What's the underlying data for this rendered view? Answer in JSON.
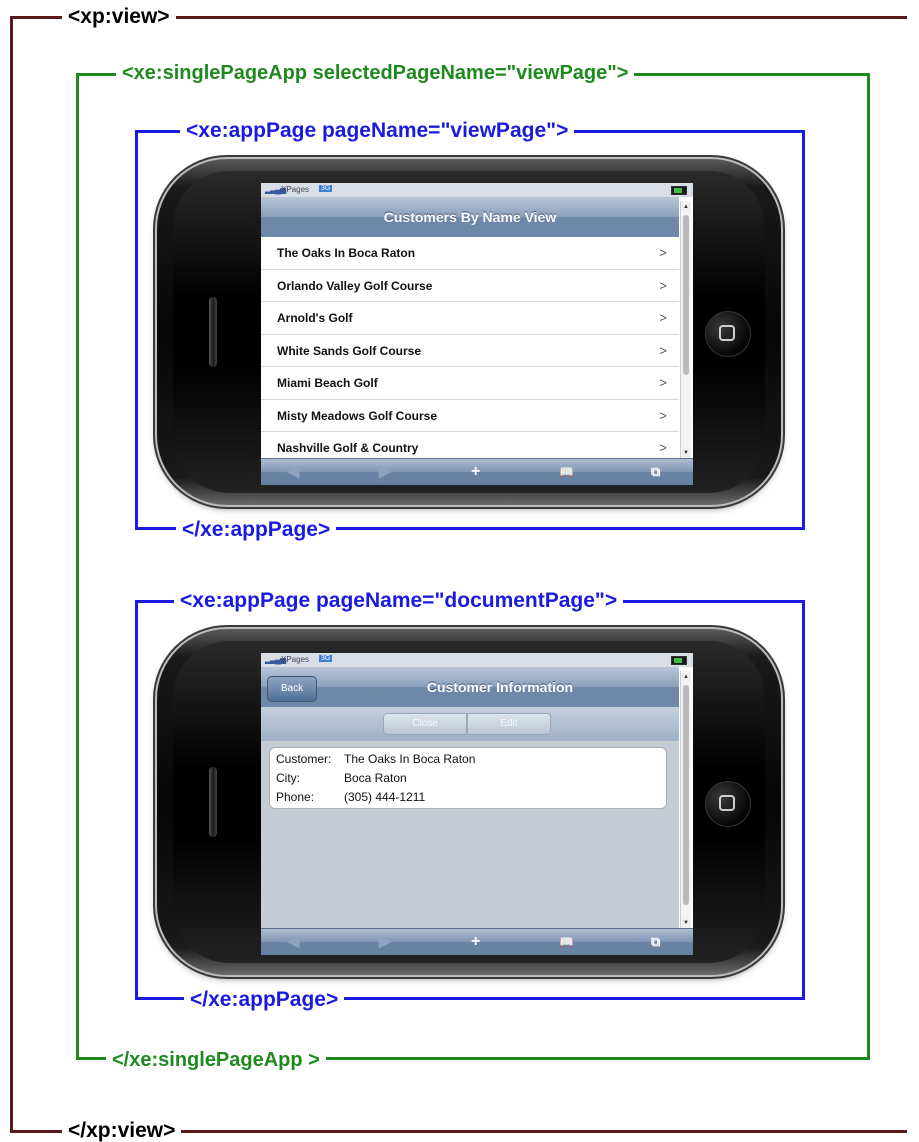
{
  "labels": {
    "view_open": "<xp:view>",
    "view_close": "</xp:view>",
    "spa_open": "<xe:singlePageApp  selectedPageName=\"viewPage\">",
    "spa_close": "</xe:singlePageApp >",
    "app1_open": "<xe:appPage  pageName=\"viewPage\">",
    "app1_close": "</xe:appPage>",
    "app2_open": "<xe:appPage  pageName=\"documentPage\">",
    "app2_close": "</xe:appPage>"
  },
  "colors": {
    "view": "#5a1a1a",
    "single_page_app": "#1e8a1e",
    "app_page": "#1a1ae0"
  },
  "status_bar": {
    "signal": "▂▃▄▅",
    "carrier": "XPages",
    "network": "3G"
  },
  "view_page": {
    "title": "Customers By Name View",
    "items": [
      "The Oaks In Boca Raton",
      "Orlando Valley Golf Course",
      "Arnold's Golf",
      "White Sands Golf Course",
      "Miami Beach Golf",
      "Misty Meadows Golf Course",
      "Nashville Golf & Country"
    ],
    "chevron": ">"
  },
  "document_page": {
    "back_label": "Back",
    "title": "Customer Information",
    "close_label": "Close",
    "edit_label": "Edit",
    "fields": [
      {
        "key": "Customer:",
        "value": "The Oaks In Boca Raton"
      },
      {
        "key": "City:",
        "value": "Boca Raton"
      },
      {
        "key": "Phone:",
        "value": "(305) 444-1211"
      }
    ]
  },
  "toolbar": {
    "back": "◀",
    "forward": "▶",
    "add": "+",
    "bookmarks": "📖",
    "tabs": "⧉"
  }
}
